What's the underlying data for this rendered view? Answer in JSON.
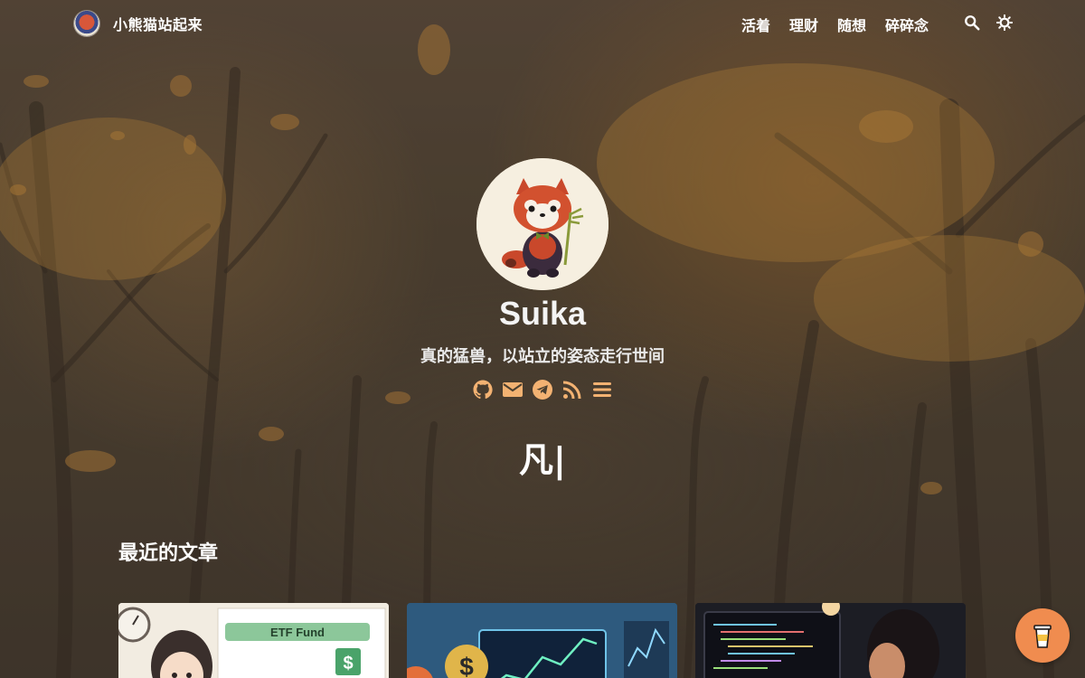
{
  "header": {
    "site_name": "小熊猫站起来",
    "nav": [
      {
        "label": "活着"
      },
      {
        "label": "理财"
      },
      {
        "label": "随想"
      },
      {
        "label": "碎碎念"
      }
    ],
    "icons": [
      "search-icon",
      "theme-toggle-icon"
    ]
  },
  "profile": {
    "name": "Suika",
    "subtitle": "真的猛兽，以站立的姿态走行世间",
    "social_icons": [
      "github-icon",
      "email-icon",
      "telegram-icon",
      "rss-icon",
      "menu-icon"
    ],
    "social_color": "#f3b272"
  },
  "logo_mark": "凡|",
  "recent": {
    "title": "最近的文章",
    "cards": [
      {
        "image": "etf-fund-illustration",
        "label": "ETF Fund"
      },
      {
        "image": "finance-dashboard-illustration"
      },
      {
        "image": "coding-at-laptop-illustration"
      }
    ]
  },
  "floating_button": {
    "icon": "coffee-cup-icon",
    "color": "#f08c4f"
  }
}
